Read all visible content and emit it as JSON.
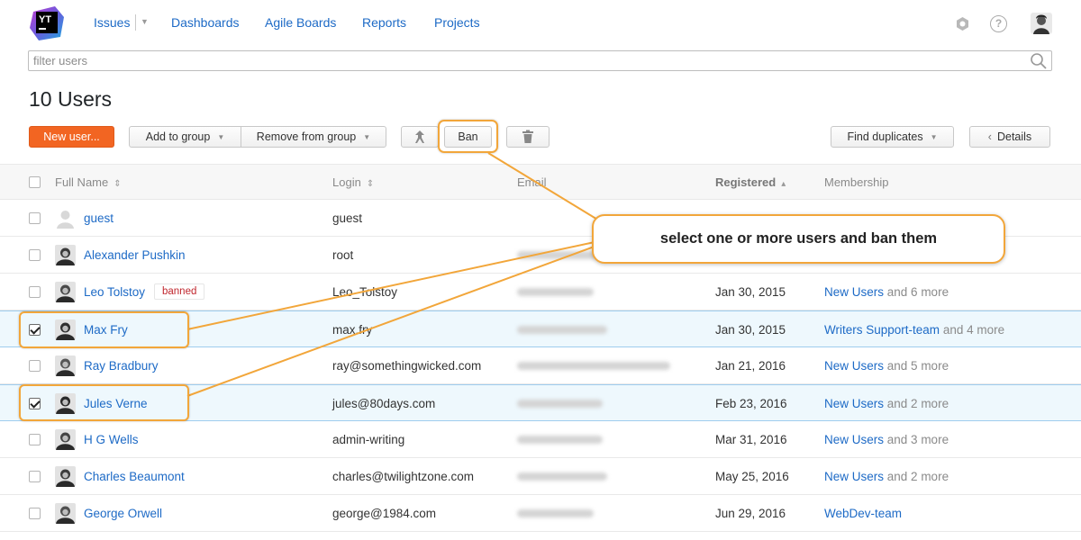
{
  "nav": {
    "logo_text": "YT",
    "items": [
      "Issues",
      "Dashboards",
      "Agile Boards",
      "Reports",
      "Projects"
    ]
  },
  "filter": {
    "placeholder": "filter users"
  },
  "page_title": "10 Users",
  "toolbar": {
    "new_user": "New user...",
    "add_to_group": "Add to group",
    "remove_from_group": "Remove from group",
    "ban": "Ban",
    "find_duplicates": "Find duplicates",
    "details": "Details"
  },
  "columns": {
    "full_name": "Full Name",
    "login": "Login",
    "email": "Email",
    "registered": "Registered",
    "membership": "Membership"
  },
  "rows": [
    {
      "name": "guest",
      "login": "guest",
      "registered": "",
      "group": "",
      "more": "",
      "checked": false,
      "banned": ""
    },
    {
      "name": "Alexander Pushkin",
      "login": "root",
      "registered": "",
      "group": "",
      "more": "",
      "checked": false,
      "banned": ""
    },
    {
      "name": "Leo Tolstoy",
      "login": "Leo_Tolstoy",
      "registered": "Jan 30, 2015",
      "group": "New Users",
      "more": "and 6 more",
      "checked": false,
      "banned": "banned"
    },
    {
      "name": "Max Fry",
      "login": "max.fry",
      "registered": "Jan 30, 2015",
      "group": "Writers Support-team",
      "more": "and 4 more",
      "checked": true,
      "banned": ""
    },
    {
      "name": "Ray Bradbury",
      "login": "ray@somethingwicked.com",
      "registered": "Jan 21, 2016",
      "group": "New Users",
      "more": "and 5 more",
      "checked": false,
      "banned": ""
    },
    {
      "name": "Jules Verne",
      "login": "jules@80days.com",
      "registered": "Feb 23, 2016",
      "group": "New Users",
      "more": "and 2 more",
      "checked": true,
      "banned": ""
    },
    {
      "name": "H G Wells",
      "login": "admin-writing",
      "registered": "Mar 31, 2016",
      "group": "New Users",
      "more": "and 3 more",
      "checked": false,
      "banned": ""
    },
    {
      "name": "Charles Beaumont",
      "login": "charles@twilightzone.com",
      "registered": "May 25, 2016",
      "group": "New Users",
      "more": "and 2 more",
      "checked": false,
      "banned": ""
    },
    {
      "name": "George Orwell",
      "login": "george@1984.com",
      "registered": "Jun 29, 2016",
      "group": "WebDev-team",
      "more": "",
      "checked": false,
      "banned": ""
    }
  ],
  "callout": {
    "text": "select one or more users and ban them"
  }
}
